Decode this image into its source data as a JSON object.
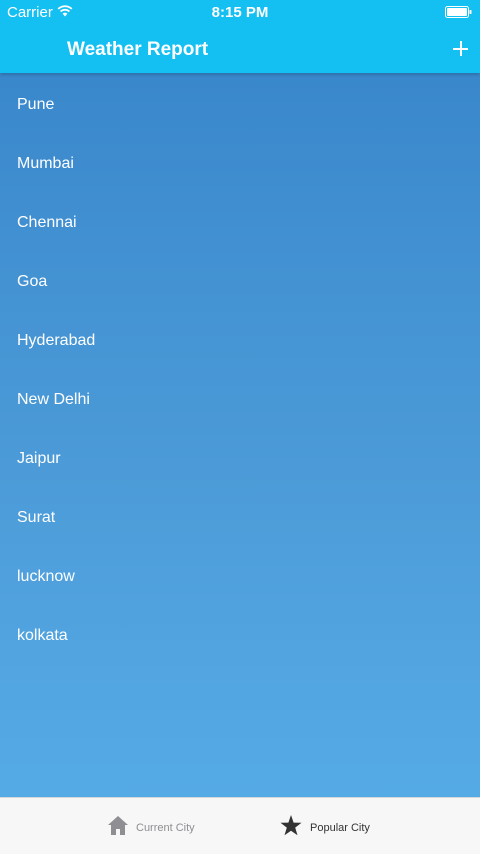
{
  "status_bar": {
    "carrier": "Carrier",
    "time": "8:15 PM"
  },
  "header": {
    "title": "Weather Report",
    "add_icon": "plus-icon"
  },
  "cities": [
    "Pune",
    "Mumbai",
    "Chennai",
    "Goa",
    "Hyderabad",
    "New Delhi",
    "Jaipur",
    "Surat",
    "lucknow",
    "kolkata"
  ],
  "tabbar": {
    "tabs": [
      {
        "label": "Current City",
        "icon": "home-icon"
      },
      {
        "label": "Popular City",
        "icon": "star-icon"
      }
    ]
  },
  "colors": {
    "header": "#14bff2",
    "list_top": "#3a88cc",
    "list_bottom": "#55abe6",
    "tabbar": "#f7f7f7"
  }
}
